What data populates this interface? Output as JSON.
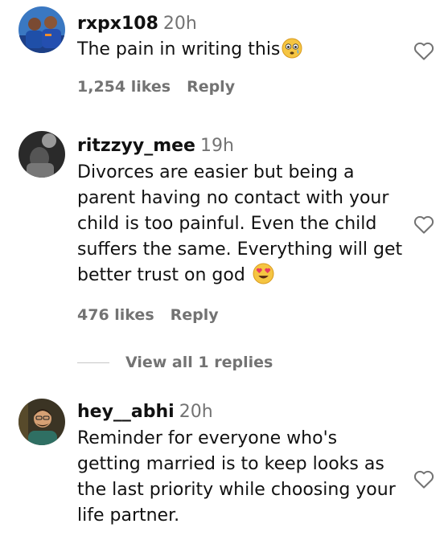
{
  "comments": [
    {
      "username": "rxpx108",
      "time": "20h",
      "lines": [
        "The pain in writing this"
      ],
      "emoji": "flushed-face",
      "likes": "1,254 likes",
      "reply": "Reply"
    },
    {
      "username": "ritzzyy_mee",
      "time": "19h",
      "lines": [
        "Divorces are easier but being a",
        "parent having no contact with your",
        "child is too painful. Even the child",
        "suffers the same. Everything will get",
        "better trust on god"
      ],
      "emoji": "heart-eyes",
      "likes": "476 likes",
      "reply": "Reply",
      "view_replies": "View all 1 replies"
    },
    {
      "username": "hey__abhi",
      "time": "20h",
      "lines": [
        "Reminder for everyone who's",
        "getting married is to keep looks as",
        "the last priority while choosing your",
        "life partner."
      ]
    }
  ],
  "colors": {
    "text": "#111111",
    "muted": "#737373",
    "divider": "#c7c7c7"
  }
}
